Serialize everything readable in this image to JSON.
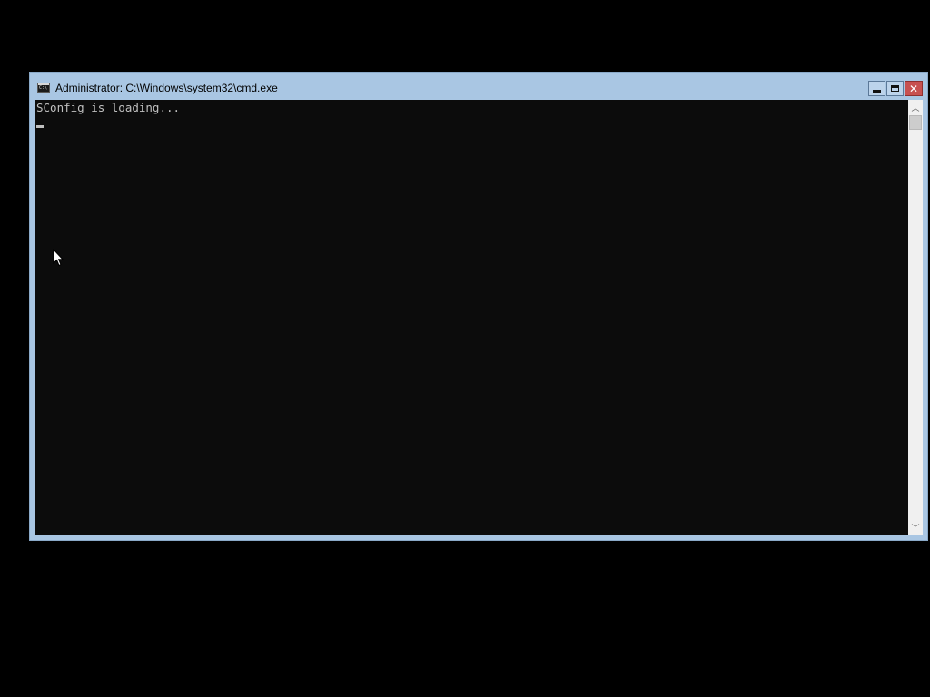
{
  "window": {
    "title": "Administrator: C:\\Windows\\system32\\cmd.exe",
    "icon": "console-icon"
  },
  "controls": {
    "minimize": "minimize-icon",
    "maximize": "maximize-icon",
    "close_glyph": "✕"
  },
  "console": {
    "lines": [
      "SConfig is loading..."
    ],
    "text_color": "#c0c0c0",
    "background": "#0c0c0c"
  },
  "scrollbar": {
    "up_glyph": "︿",
    "down_glyph": "﹀"
  },
  "colors": {
    "desktop": "#000000",
    "frame": "#a9c6e3",
    "close_button": "#c75050"
  }
}
